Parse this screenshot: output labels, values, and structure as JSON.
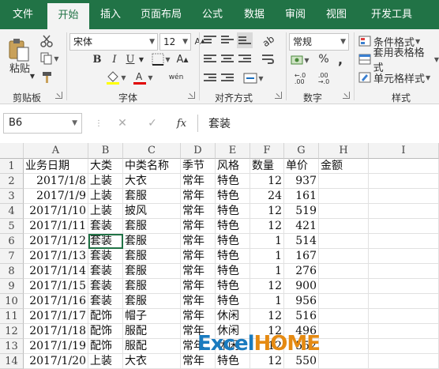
{
  "tabs": [
    "文件",
    "开始",
    "插入",
    "页面布局",
    "公式",
    "数据",
    "审阅",
    "视图",
    "开发工具"
  ],
  "active_tab": "开始",
  "clipboard": {
    "paste_label": "粘贴",
    "group_label": "剪贴板"
  },
  "font": {
    "name": "宋体",
    "size": "12",
    "bold": "B",
    "italic": "I",
    "underline": "U",
    "phonetic": "wén",
    "group_label": "字体"
  },
  "alignment": {
    "group_label": "对齐方式"
  },
  "number": {
    "format": "常规",
    "percent": "%",
    "comma": ",",
    "group_label": "数字"
  },
  "styles": {
    "conditional": "条件格式",
    "table": "套用表格格式",
    "cell": "单元格样式",
    "group_label": "样式"
  },
  "namebox": "B6",
  "formula": {
    "fx": "fx",
    "value": "套装"
  },
  "columns": [
    "A",
    "B",
    "C",
    "D",
    "E",
    "F",
    "G",
    "H",
    "I"
  ],
  "rows": [
    {
      "n": "1",
      "a": "业务日期",
      "b": "大类",
      "c": "中类名称",
      "d": "季节",
      "e": "风格",
      "f": "数量",
      "g": "单价",
      "h": "金额"
    },
    {
      "n": "2",
      "a": "2017/1/8",
      "b": "上装",
      "c": "大衣",
      "d": "常年",
      "e": "特色",
      "f": "12",
      "g": "937",
      "h": ""
    },
    {
      "n": "3",
      "a": "2017/1/9",
      "b": "上装",
      "c": "套服",
      "d": "常年",
      "e": "特色",
      "f": "24",
      "g": "161",
      "h": ""
    },
    {
      "n": "4",
      "a": "2017/1/10",
      "b": "上装",
      "c": "披风",
      "d": "常年",
      "e": "特色",
      "f": "12",
      "g": "519",
      "h": ""
    },
    {
      "n": "5",
      "a": "2017/1/11",
      "b": "套装",
      "c": "套服",
      "d": "常年",
      "e": "特色",
      "f": "12",
      "g": "421",
      "h": ""
    },
    {
      "n": "6",
      "a": "2017/1/12",
      "b": "套装",
      "c": "套服",
      "d": "常年",
      "e": "特色",
      "f": "1",
      "g": "514",
      "h": ""
    },
    {
      "n": "7",
      "a": "2017/1/13",
      "b": "套装",
      "c": "套服",
      "d": "常年",
      "e": "特色",
      "f": "1",
      "g": "167",
      "h": ""
    },
    {
      "n": "8",
      "a": "2017/1/14",
      "b": "套装",
      "c": "套服",
      "d": "常年",
      "e": "特色",
      "f": "1",
      "g": "276",
      "h": ""
    },
    {
      "n": "9",
      "a": "2017/1/15",
      "b": "套装",
      "c": "套服",
      "d": "常年",
      "e": "特色",
      "f": "12",
      "g": "900",
      "h": ""
    },
    {
      "n": "10",
      "a": "2017/1/16",
      "b": "套装",
      "c": "套服",
      "d": "常年",
      "e": "特色",
      "f": "1",
      "g": "956",
      "h": ""
    },
    {
      "n": "11",
      "a": "2017/1/17",
      "b": "配饰",
      "c": "帽子",
      "d": "常年",
      "e": "休闲",
      "f": "12",
      "g": "516",
      "h": ""
    },
    {
      "n": "12",
      "a": "2017/1/18",
      "b": "配饰",
      "c": "服配",
      "d": "常年",
      "e": "休闲",
      "f": "12",
      "g": "496",
      "h": ""
    },
    {
      "n": "13",
      "a": "2017/1/19",
      "b": "配饰",
      "c": "服配",
      "d": "常年",
      "e": "休闲",
      "f": "12",
      "g": "552",
      "h": ""
    },
    {
      "n": "14",
      "a": "2017/1/20",
      "b": "上装",
      "c": "大衣",
      "d": "常年",
      "e": "特色",
      "f": "12",
      "g": "550",
      "h": ""
    }
  ],
  "watermark": {
    "part1": "Excel",
    "part2": "HOME"
  },
  "colors": {
    "tab_green": "#217346",
    "selection": "#217346"
  }
}
